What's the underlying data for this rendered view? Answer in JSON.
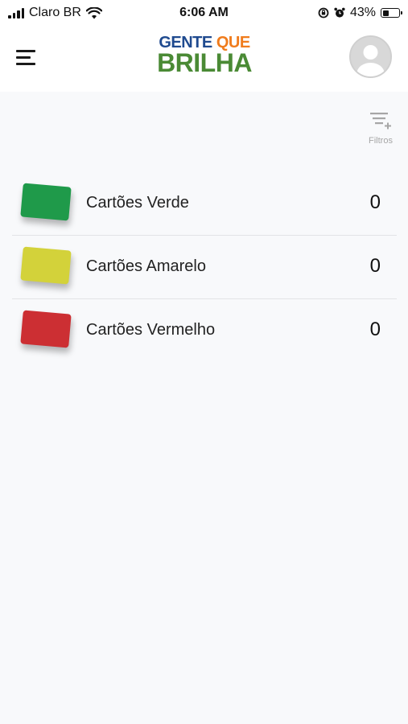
{
  "status_bar": {
    "carrier": "Claro BR",
    "time": "6:06 AM",
    "battery_percent": "43%",
    "battery_level": 0.43,
    "icons": [
      "signal-icon",
      "wifi-icon",
      "orientation-lock-icon",
      "alarm-icon",
      "battery-icon"
    ]
  },
  "header": {
    "menu_icon": "hamburger-menu-icon",
    "logo": {
      "word1": "GENTE",
      "word2": "QUE",
      "word3": "BRILHA"
    },
    "avatar_icon": "user-avatar-icon"
  },
  "filter": {
    "icon": "filter-add-icon",
    "label": "Filtros"
  },
  "colors": {
    "green_card": "#1f9a4a",
    "yellow_card": "#d3d23a",
    "red_card": "#cc2f33",
    "logo_blue": "#1f4a8f",
    "logo_orange": "#f07c1d",
    "logo_green": "#4a8a35"
  },
  "cards": [
    {
      "label": "Cartões Verde",
      "count": "0",
      "color": "#1f9a4a"
    },
    {
      "label": "Cartões Amarelo",
      "count": "0",
      "color": "#d3d23a"
    },
    {
      "label": "Cartões Vermelho",
      "count": "0",
      "color": "#cc2f33"
    }
  ]
}
